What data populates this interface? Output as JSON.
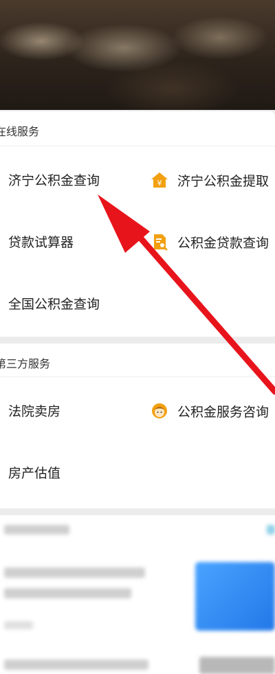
{
  "online_section": {
    "title": "在线服务",
    "items": [
      {
        "label": "济宁公积金查询"
      },
      {
        "label": "济宁公积金提取"
      },
      {
        "label": "贷款试算器"
      },
      {
        "label": "公积金贷款查询"
      },
      {
        "label": "全国公积金查询"
      }
    ]
  },
  "third_party_section": {
    "title": "第三方服务",
    "items": [
      {
        "label": "法院卖房"
      },
      {
        "label": "公积金服务咨询"
      },
      {
        "label": "房产估值"
      }
    ]
  },
  "colors": {
    "icon_orange": "#f2a012",
    "arrow_red": "#e8141c"
  },
  "icons": [
    "house-yuan-icon",
    "document-search-icon",
    "advisor-avatar-icon"
  ]
}
